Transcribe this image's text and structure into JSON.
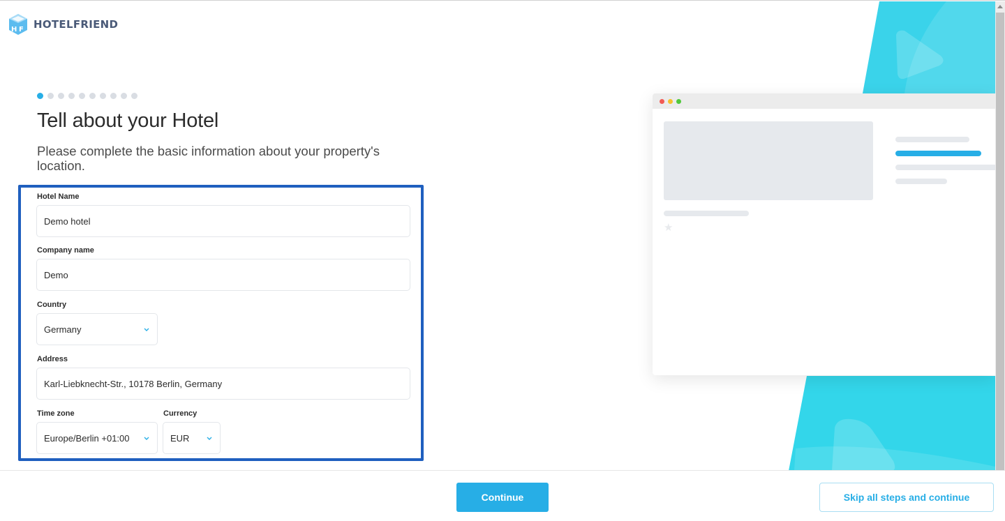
{
  "brand": {
    "name": "HOTELFRIEND",
    "logo_icon": "hf-cube-logo-icon",
    "logo_letters": [
      "H",
      "F"
    ]
  },
  "progress": {
    "total_steps": 10,
    "current_step": 1
  },
  "header": {
    "title": "Tell about your Hotel",
    "subtitle": "Please complete the basic information about your property's location."
  },
  "form": {
    "hotel_name": {
      "label": "Hotel Name",
      "value": "Demo hotel"
    },
    "company_name": {
      "label": "Company name",
      "value": "Demo"
    },
    "country": {
      "label": "Country",
      "value": "Germany",
      "icon": "chevron-down-icon"
    },
    "address": {
      "label": "Address",
      "value": "Karl-Liebknecht-Str., 10178 Berlin, Germany"
    },
    "time_zone": {
      "label": "Time zone",
      "value": "Europe/Berlin +01:00",
      "icon": "chevron-down-icon"
    },
    "currency": {
      "label": "Currency",
      "value": "EUR",
      "icon": "chevron-down-icon"
    }
  },
  "preview": {
    "window_dots": [
      "#f25a54",
      "#f5c12e",
      "#51c83c"
    ],
    "accent_line_color": "#27aee6",
    "star_icon": "star-icon"
  },
  "footer": {
    "continue_label": "Continue",
    "skip_label": "Skip all steps and continue"
  },
  "colors": {
    "accent": "#27aee6",
    "highlight_frame": "#1f5fbf",
    "decor_cyan": "#33d4e8",
    "brand_text": "#4a5a78"
  }
}
